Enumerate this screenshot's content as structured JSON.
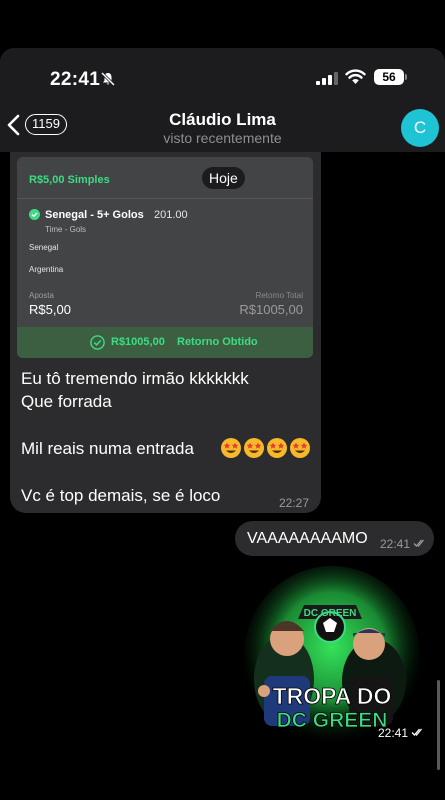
{
  "status_bar": {
    "time": "22:41",
    "battery": "56"
  },
  "header": {
    "back_count": "1159",
    "contact_name": "Cláudio Lima",
    "contact_status": "visto recentemente",
    "avatar_initial": "C"
  },
  "date_chip": "Hoje",
  "bet_card": {
    "title": "R$5,00 Simples",
    "selection": "Senegal - 5+ Golos",
    "odd": "201.00",
    "market": "Time - Gols",
    "team_home": "Senegal",
    "team_away": "Argentina",
    "stake_label": "Aposta",
    "stake_value": "R$5,00",
    "return_label": "Retorno Total",
    "return_value": "R$1005,00",
    "result_amount": "R$1005,00",
    "result_label": "Retorno Obtido"
  },
  "incoming_message": {
    "lines": [
      "Eu tô tremendo irmão kkkkkkk",
      "Que forrada",
      "Mil reais numa entrada",
      "Vc é top demais, se é loco"
    ],
    "time": "22:27"
  },
  "outgoing_message": {
    "text": "VAAAAAAAAMO",
    "time": "22:41"
  },
  "sticker": {
    "badge_text": "DC GREEN",
    "line1": "TROPA DO",
    "line2": "DC GREEN",
    "time": "22:41"
  },
  "colors": {
    "accent_green": "#3ddc84",
    "avatar": "#1ec3d4",
    "bubble": "#2c2c2e"
  }
}
